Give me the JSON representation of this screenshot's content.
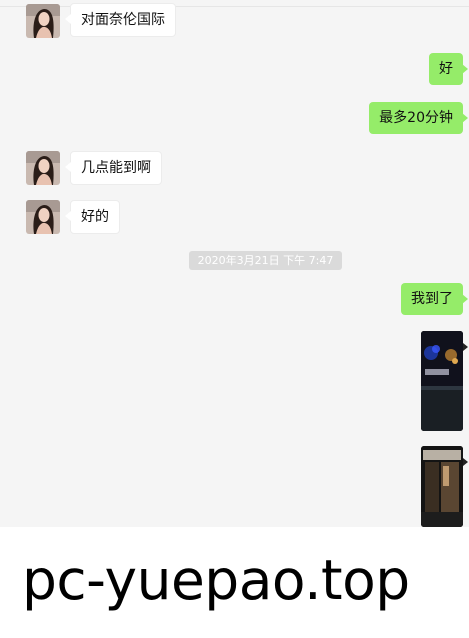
{
  "messages": {
    "m1": "对面奈伦国际",
    "m2": "好",
    "m3": "最多20分钟",
    "m4": "几点能到啊",
    "m5": "好的",
    "m6": "我到了"
  },
  "timestamp": "2020年3月21日 下午 7:47",
  "watermark": "pc-yuepao.top",
  "colors": {
    "background": "#f5f5f5",
    "outgoing_bubble": "#95ec69",
    "incoming_bubble": "#ffffff",
    "timestamp_bg": "#dadada"
  },
  "icons": {
    "contact_avatar": "contact-avatar-photo"
  }
}
